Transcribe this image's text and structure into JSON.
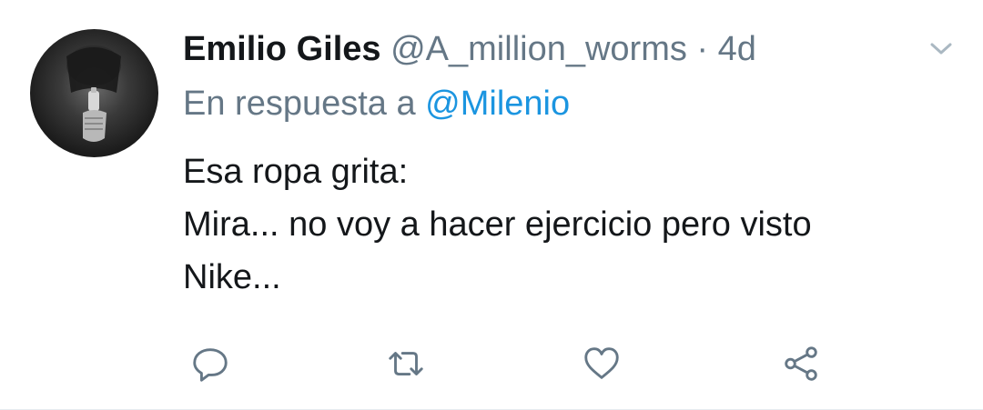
{
  "tweet": {
    "author_name": "Emilio Giles",
    "author_handle": "@A_million_worms",
    "separator": "·",
    "timestamp": "4d",
    "reply_prefix": "En respuesta a",
    "reply_mention": "@Milenio",
    "body_lines": [
      "Esa ropa grita:",
      "Mira... no voy a hacer ejercicio pero visto",
      "Nike..."
    ]
  },
  "icons": {
    "caret": "chevron-down-icon",
    "reply": "reply-icon",
    "retweet": "retweet-icon",
    "like": "heart-icon",
    "share": "share-icon"
  },
  "colors": {
    "text_primary": "#14171a",
    "text_secondary": "#657786",
    "link": "#1b95e0",
    "icon": "#657786"
  }
}
